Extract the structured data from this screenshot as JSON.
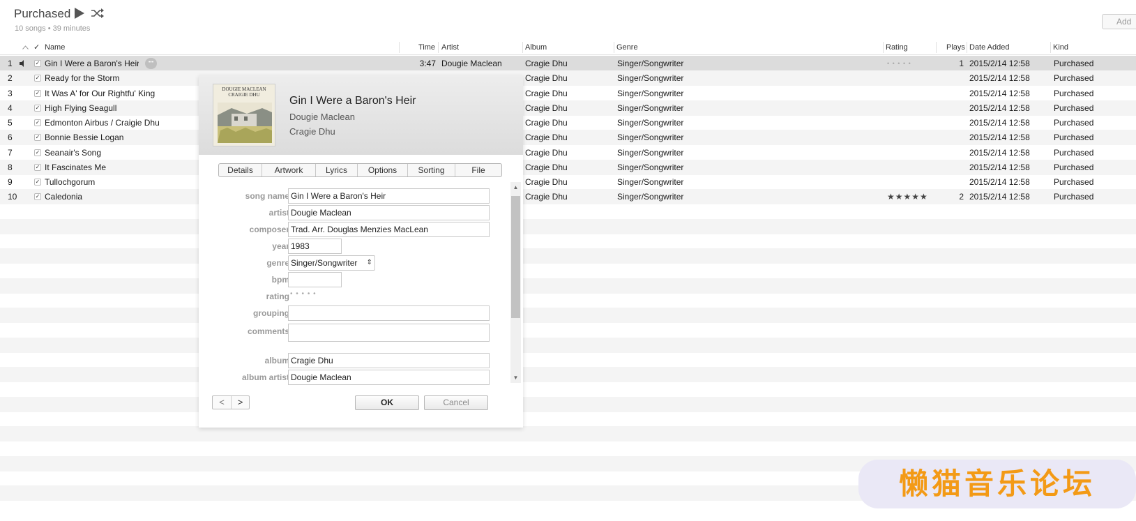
{
  "playlist": {
    "title": "Purchased",
    "subtitle": "10 songs • 39 minutes",
    "add_label": "Add"
  },
  "columns": {
    "check": "✓",
    "name": "Name",
    "time": "Time",
    "artist": "Artist",
    "album": "Album",
    "genre": "Genre",
    "rating": "Rating",
    "plays": "Plays",
    "date_added": "Date Added",
    "kind": "Kind"
  },
  "songs": [
    {
      "num": "1",
      "name": "Gin I Were a Baron's Heir",
      "time": "3:47",
      "artist": "Dougie Maclean",
      "album": "Cragie Dhu",
      "genre": "Singer/Songwriter",
      "rating": "• • • • •",
      "plays": "1",
      "date": "2015/2/14 12:58",
      "kind": "Purchased"
    },
    {
      "num": "2",
      "name": "Ready for the Storm",
      "time": "",
      "artist": "",
      "album": "Cragie Dhu",
      "genre": "Singer/Songwriter",
      "rating": "",
      "plays": "",
      "date": "2015/2/14 12:58",
      "kind": "Purchased"
    },
    {
      "num": "3",
      "name": "It Was A' for Our Rightfu' King",
      "time": "",
      "artist": "",
      "album": "Cragie Dhu",
      "genre": "Singer/Songwriter",
      "rating": "",
      "plays": "",
      "date": "2015/2/14 12:58",
      "kind": "Purchased"
    },
    {
      "num": "4",
      "name": "High Flying Seagull",
      "time": "",
      "artist": "",
      "album": "Cragie Dhu",
      "genre": "Singer/Songwriter",
      "rating": "",
      "plays": "",
      "date": "2015/2/14 12:58",
      "kind": "Purchased"
    },
    {
      "num": "5",
      "name": "Edmonton Airbus / Craigie Dhu",
      "time": "",
      "artist": "",
      "album": "Cragie Dhu",
      "genre": "Singer/Songwriter",
      "rating": "",
      "plays": "",
      "date": "2015/2/14 12:58",
      "kind": "Purchased"
    },
    {
      "num": "6",
      "name": "Bonnie Bessie Logan",
      "time": "",
      "artist": "",
      "album": "Cragie Dhu",
      "genre": "Singer/Songwriter",
      "rating": "",
      "plays": "",
      "date": "2015/2/14 12:58",
      "kind": "Purchased"
    },
    {
      "num": "7",
      "name": "Seanair's Song",
      "time": "",
      "artist": "",
      "album": "Cragie Dhu",
      "genre": "Singer/Songwriter",
      "rating": "",
      "plays": "",
      "date": "2015/2/14 12:58",
      "kind": "Purchased"
    },
    {
      "num": "8",
      "name": "It Fascinates Me",
      "time": "",
      "artist": "",
      "album": "Cragie Dhu",
      "genre": "Singer/Songwriter",
      "rating": "",
      "plays": "",
      "date": "2015/2/14 12:58",
      "kind": "Purchased"
    },
    {
      "num": "9",
      "name": "Tullochgorum",
      "time": "",
      "artist": "",
      "album": "Cragie Dhu",
      "genre": "Singer/Songwriter",
      "rating": "",
      "plays": "",
      "date": "2015/2/14 12:58",
      "kind": "Purchased"
    },
    {
      "num": "10",
      "name": "Caledonia",
      "time": "",
      "artist": "",
      "album": "Cragie Dhu",
      "genre": "Singer/Songwriter",
      "rating": "★★★★★",
      "plays": "2",
      "date": "2015/2/14 12:58",
      "kind": "Purchased"
    }
  ],
  "dialog": {
    "art_text": "DOUGIE MACLEAN\nCRAIGIE DHU",
    "title": "Gin I Were a Baron's Heir",
    "artist": "Dougie Maclean",
    "album": "Cragie Dhu",
    "tabs": [
      "Details",
      "Artwork",
      "Lyrics",
      "Options",
      "Sorting",
      "File"
    ],
    "labels": {
      "song_name": "song name",
      "artist": "artist",
      "composer": "composer",
      "year": "year",
      "genre": "genre",
      "bpm": "bpm",
      "rating": "rating",
      "grouping": "grouping",
      "comments": "comments",
      "album": "album",
      "album_artist": "album artist"
    },
    "values": {
      "song_name": "Gin I Were a Baron's Heir",
      "artist": "Dougie Maclean",
      "composer": "Trad. Arr. Douglas Menzies MacLean",
      "year": "1983",
      "genre": "Singer/Songwriter",
      "bpm": "",
      "rating": "• • • • •",
      "grouping": "",
      "comments": "",
      "album": "Cragie Dhu",
      "album_artist": "Dougie Maclean"
    },
    "ok_label": "OK",
    "cancel_label": "Cancel",
    "prev_label": "<",
    "next_label": ">"
  },
  "watermark": "懒猫音乐论坛"
}
